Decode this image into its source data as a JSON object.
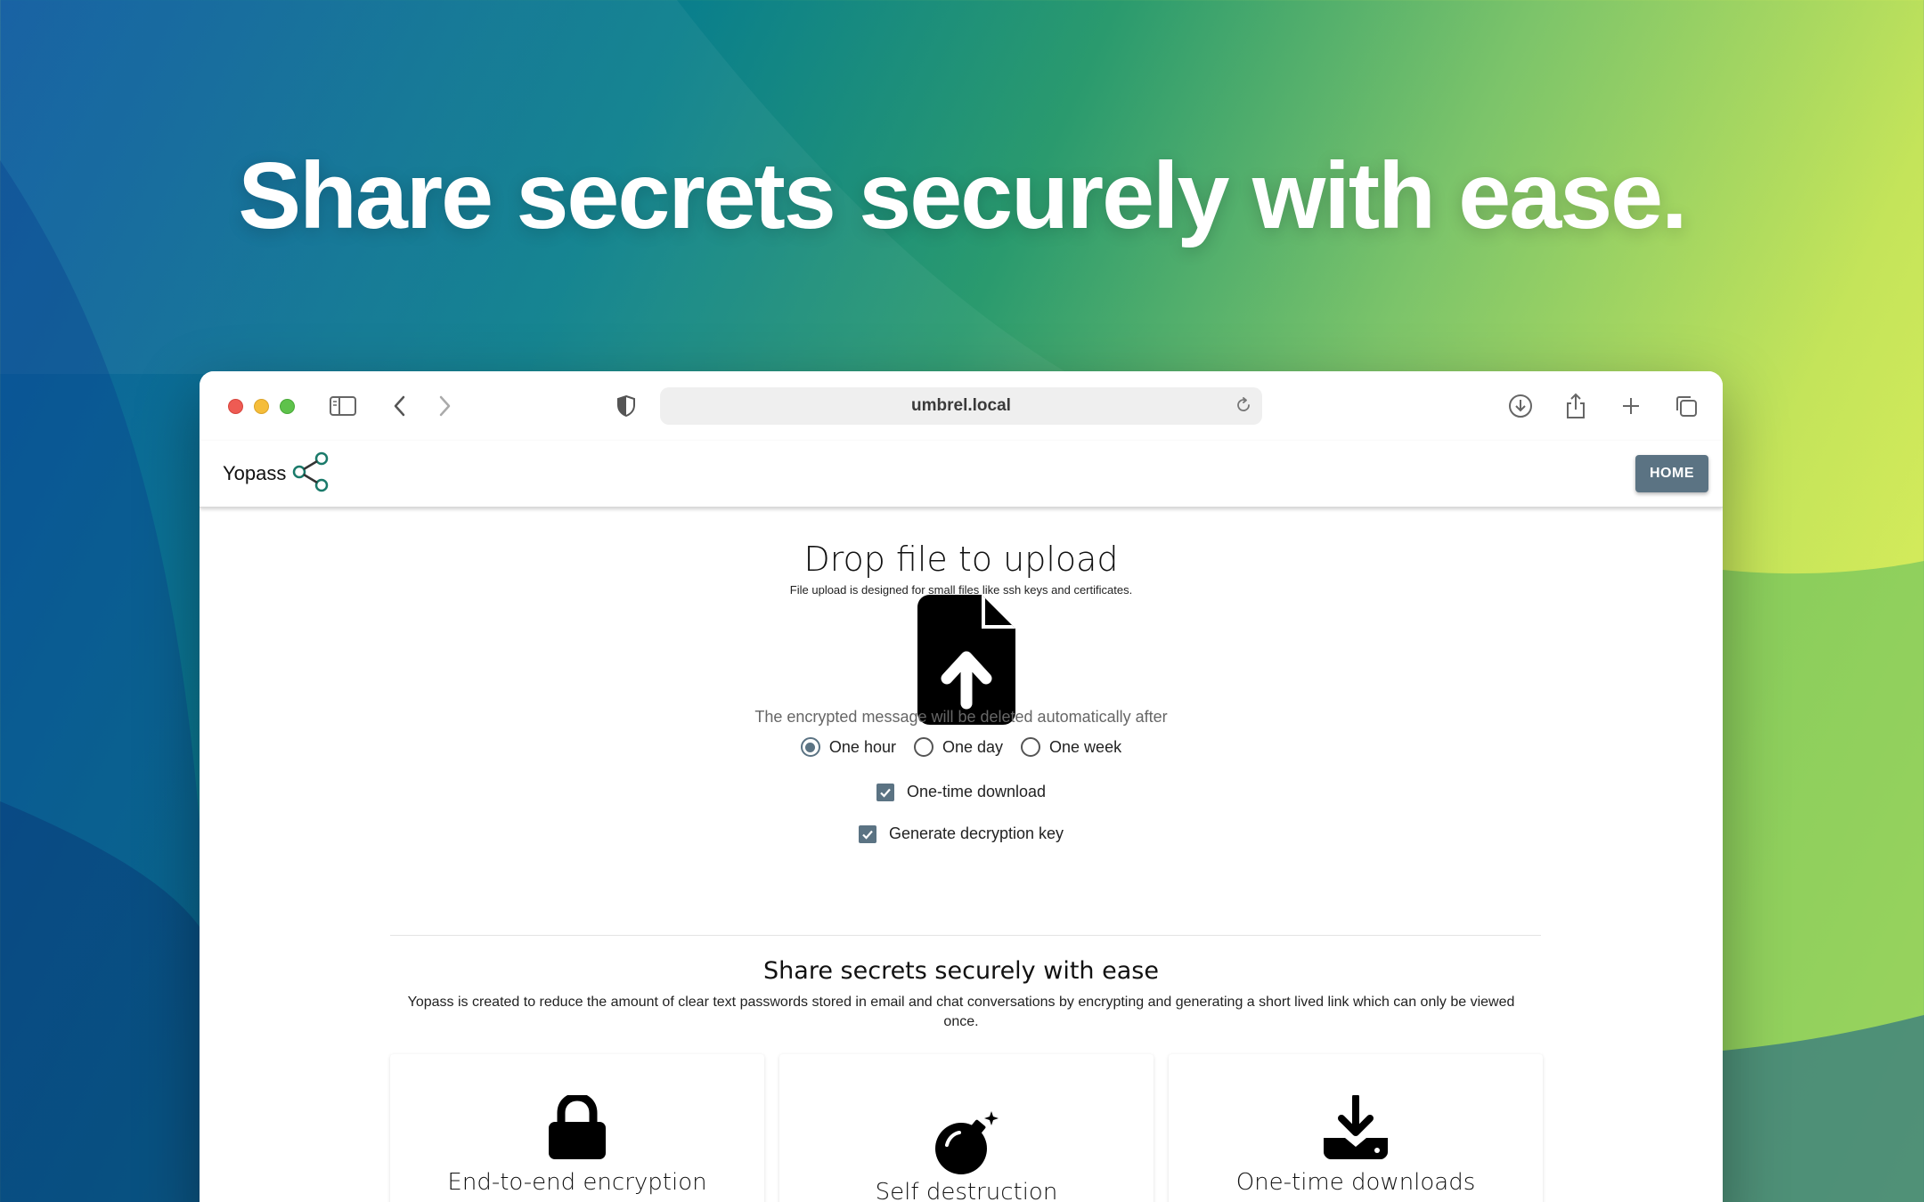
{
  "marketing": {
    "headline": "Share secrets securely with ease."
  },
  "browser": {
    "url": "umbrel.local",
    "icons": [
      "sidebar-icon",
      "back-icon",
      "forward-icon",
      "shield-icon",
      "reload-icon",
      "download-icon",
      "share-icon",
      "new-tab-icon",
      "tabs-overview-icon"
    ]
  },
  "app": {
    "brand": "Yopass",
    "brand_icon": "share-nodes-icon",
    "home_label": "HOME",
    "accent_color": "#5b7383"
  },
  "upload": {
    "title": "Drop file to upload",
    "subtitle": "File upload is designed for small files like ssh keys and certificates.",
    "icon": "file-upload-icon",
    "expire_text": "The encrypted message will be deleted automatically after",
    "expiration_options": [
      {
        "label": "One hour",
        "selected": true
      },
      {
        "label": "One day",
        "selected": false
      },
      {
        "label": "One week",
        "selected": false
      }
    ],
    "one_time_download": {
      "label": "One-time download",
      "checked": true
    },
    "generate_key": {
      "label": "Generate decryption key",
      "checked": true
    }
  },
  "about": {
    "title": "Share secrets securely with ease",
    "body": "Yopass is created to reduce the amount of clear text passwords stored in email and chat conversations by encrypting and generating a short lived link which can only be viewed once."
  },
  "features": [
    {
      "title": "End-to-end encryption",
      "icon": "lock-icon"
    },
    {
      "title": "Self destruction",
      "icon": "bomb-icon"
    },
    {
      "title": "One-time downloads",
      "icon": "download-tray-icon"
    }
  ]
}
